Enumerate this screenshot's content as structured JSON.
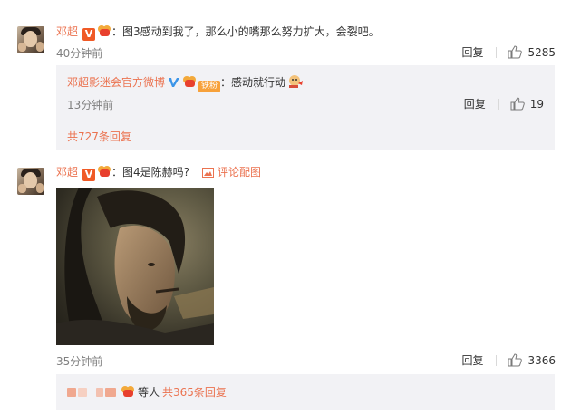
{
  "comments": [
    {
      "username": "邓超",
      "vbadge": "V",
      "text": "：图3感动到我了，那么小的嘴那么努力扩大，会裂吧。",
      "time": "40分钟前",
      "reply_label": "回复",
      "likes": "5285",
      "subreply": {
        "username": "邓超影迷会官方微博",
        "fan_badge": "铁粉",
        "text": "：感动就行动",
        "time": "13分钟前",
        "reply_label": "回复",
        "likes": "19"
      },
      "more_replies": "共727条回复"
    },
    {
      "username": "邓超",
      "vbadge": "V",
      "text": "：图4是陈赫吗?",
      "pic_link": "评论配图",
      "time": "35分钟前",
      "reply_label": "回复",
      "likes": "3366",
      "others_text": "等人",
      "more_replies": "共365条回复"
    }
  ],
  "colors": {
    "accent": "#eb7350",
    "meta": "#808080",
    "subbox_bg": "#f2f2f5",
    "verified_blue": "#3b95e8"
  }
}
